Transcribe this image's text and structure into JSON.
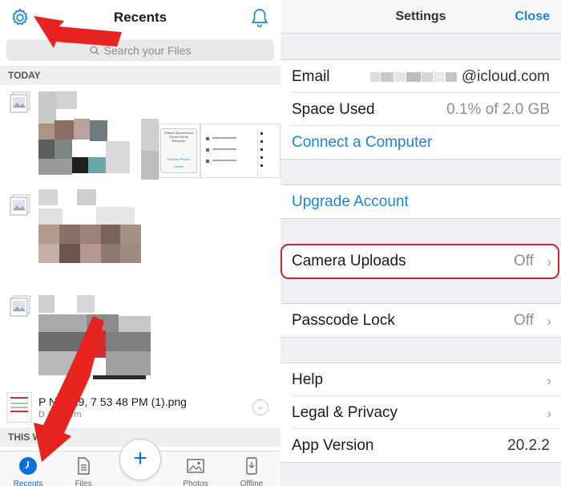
{
  "left": {
    "title": "Recents",
    "search_placeholder": "Search your Files",
    "sections": {
      "today": "TODAY",
      "this_week": "THIS WEEK"
    },
    "thumbnail_text": {
      "dialog_title": "Photos Synced from iTunes will be Removed",
      "dialog_button_1": "Remove Photos",
      "dialog_button_2": "Cancel"
    },
    "file": {
      "name": "P Nov 29, 7 53 48 PM (1).png",
      "path": "D > Dharm"
    },
    "tabs": [
      {
        "label": "Recents",
        "icon": "clock-icon"
      },
      {
        "label": "Files",
        "icon": "file-icon"
      },
      {
        "label": "Photos",
        "icon": "photo-icon"
      },
      {
        "label": "Offline",
        "icon": "phone-icon"
      }
    ],
    "fab_label": "+"
  },
  "settings": {
    "title": "Settings",
    "close_label": "Close",
    "email_label": "Email",
    "email_value": "@icloud.com",
    "space_label": "Space Used",
    "space_value": "0.1% of 2.0 GB",
    "connect_label": "Connect a Computer",
    "upgrade_label": "Upgrade Account",
    "camera_label": "Camera Uploads",
    "camera_value": "Off",
    "passcode_label": "Passcode Lock",
    "passcode_value": "Off",
    "help_label": "Help",
    "legal_label": "Legal & Privacy",
    "version_label": "App Version",
    "version_value": "20.2.2"
  },
  "colors": {
    "accent": "#1a86d9",
    "highlight": "#c0272d",
    "arrow": "#e6231f"
  }
}
